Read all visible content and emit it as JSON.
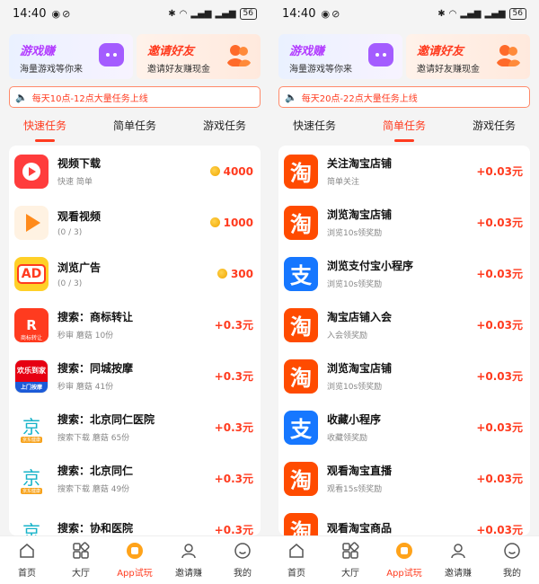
{
  "status": {
    "time": "14:40",
    "battery": "56"
  },
  "banners": {
    "game": {
      "title": "游戏赚",
      "subtitle": "海量游戏等你来"
    },
    "invite": {
      "title": "邀请好友",
      "subtitle": "邀请好友赚现金"
    }
  },
  "tabs": [
    "快速任务",
    "简单任务",
    "游戏任务"
  ],
  "left": {
    "notice": "每天10点-12点大量任务上线",
    "active_tab": 0,
    "tasks": [
      {
        "icon": "video-play-icon",
        "title": "视频下载",
        "sub": "快速  简单",
        "reward": "4000",
        "coin": true
      },
      {
        "icon": "watch-video-icon",
        "title": "观看视频",
        "sub": "(0 / 3)",
        "reward": "1000",
        "coin": true
      },
      {
        "icon": "ad-icon",
        "title": "浏览广告",
        "sub": "(0 / 3)",
        "reward": "300",
        "coin": true
      },
      {
        "icon": "trademark-app-icon",
        "title": "搜索：商标转让",
        "sub": "秒审  蘑菇  10份",
        "reward": "+0.3元",
        "coin": false,
        "icon_text": "R",
        "icon_small": "商标转让"
      },
      {
        "icon": "massage-app-icon",
        "title": "搜索：同城按摩",
        "sub": "秒审  蘑菇  41份",
        "reward": "+0.3元",
        "coin": false,
        "icon_text": "欢乐到家",
        "icon_small": "上门按摩"
      },
      {
        "icon": "jd-health-icon",
        "title": "搜索：北京同仁医院",
        "sub": "搜索下载  蘑菇  65份",
        "reward": "+0.3元",
        "coin": false,
        "icon_text": "京",
        "icon_small": "京东健康"
      },
      {
        "icon": "jd-health-icon",
        "title": "搜索：北京同仁",
        "sub": "搜索下载  蘑菇  49份",
        "reward": "+0.3元",
        "coin": false,
        "icon_text": "京",
        "icon_small": "京东健康"
      },
      {
        "icon": "jd-health-icon",
        "title": "搜索：协和医院",
        "sub": "",
        "reward": "+0.3元",
        "coin": false,
        "icon_text": "京",
        "icon_small": ""
      }
    ]
  },
  "right": {
    "notice": "每天20点-22点大量任务上线",
    "active_tab": 1,
    "tasks": [
      {
        "icon": "taobao-icon",
        "icon_text": "淘",
        "title": "关注淘宝店铺",
        "sub": "简单关注",
        "reward": "+0.03元"
      },
      {
        "icon": "taobao-icon",
        "icon_text": "淘",
        "title": "浏览淘宝店铺",
        "sub": "浏览10s领奖励",
        "reward": "+0.03元"
      },
      {
        "icon": "alipay-icon",
        "icon_text": "支",
        "title": "浏览支付宝小程序",
        "sub": "浏览10s领奖励",
        "reward": "+0.03元"
      },
      {
        "icon": "taobao-icon",
        "icon_text": "淘",
        "title": "淘宝店铺入会",
        "sub": "入会领奖励",
        "reward": "+0.03元"
      },
      {
        "icon": "taobao-icon",
        "icon_text": "淘",
        "title": "浏览淘宝店铺",
        "sub": "浏览10s领奖励",
        "reward": "+0.03元"
      },
      {
        "icon": "alipay-icon",
        "icon_text": "支",
        "title": "收藏小程序",
        "sub": "收藏领奖励",
        "reward": "+0.03元"
      },
      {
        "icon": "taobao-icon",
        "icon_text": "淘",
        "title": "观看淘宝直播",
        "sub": "观看15s领奖励",
        "reward": "+0.03元"
      },
      {
        "icon": "taobao-icon",
        "icon_text": "淘",
        "title": "观看淘宝商品",
        "sub": "",
        "reward": "+0.03元"
      }
    ]
  },
  "nav": [
    {
      "label": "首页",
      "icon": "home-icon"
    },
    {
      "label": "大厅",
      "icon": "grid-icon"
    },
    {
      "label": "App试玩",
      "icon": "app-trial-icon"
    },
    {
      "label": "邀请赚",
      "icon": "person-icon"
    },
    {
      "label": "我的",
      "icon": "face-icon"
    }
  ],
  "colors": {
    "accent": "#ff3b1f",
    "taobao": "#ff4b00",
    "alipay": "#1677ff"
  }
}
